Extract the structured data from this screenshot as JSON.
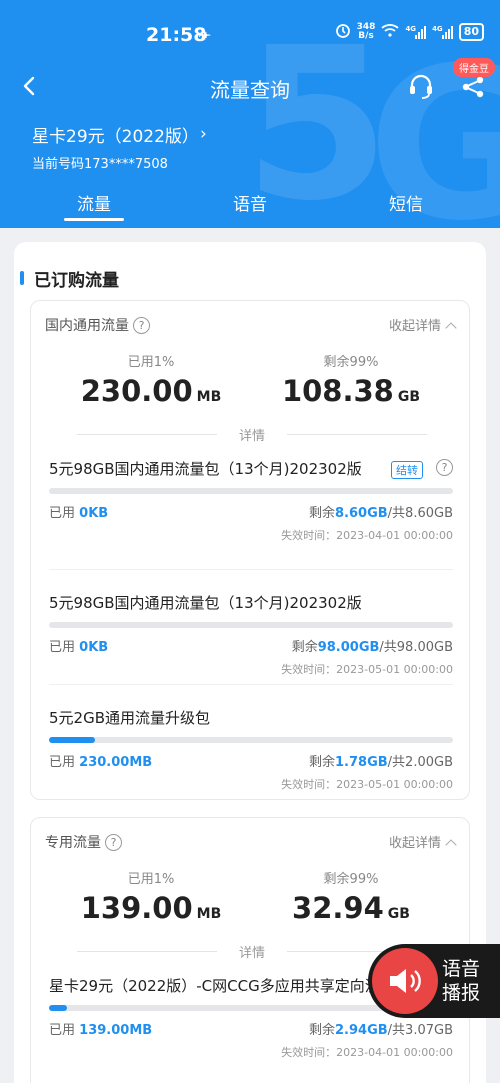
{
  "status_bar": {
    "time": "21:58",
    "speed_value": "348",
    "speed_unit": "B/s",
    "signal_label_1": "4G",
    "signal_label_2": "4G",
    "battery": "80"
  },
  "nav": {
    "title": "流量查询",
    "badge": "得金豆"
  },
  "plan": {
    "name": "星卡29元（2022版）",
    "phone": "当前号码173****7508"
  },
  "tabs": [
    "流量",
    "语音",
    "短信"
  ],
  "subscribed": {
    "title": "已订购流量",
    "domestic": {
      "title": "国内通用流量",
      "collapse_label": "收起详情",
      "used_label": "已用1%",
      "used_value": "230.00",
      "used_unit": "MB",
      "remain_label": "剩余99%",
      "remain_value": "108.38",
      "remain_unit": "GB",
      "detail_label": "详情",
      "packages": [
        {
          "name": "5元98GB国内通用流量包（13个月)202302版",
          "tag": "结转",
          "used_prefix": "已用",
          "used": "0KB",
          "remain_prefix": "剩余",
          "remain": "8.60GB",
          "total": "/共8.60GB",
          "expiry": "失效时间：2023-04-01 00:00:00",
          "progress": 0
        },
        {
          "name": "5元98GB国内通用流量包（13个月)202302版",
          "used_prefix": "已用",
          "used": "0KB",
          "remain_prefix": "剩余",
          "remain": "98.00GB",
          "total": "/共98.00GB",
          "expiry": "失效时间：2023-05-01 00:00:00",
          "progress": 0
        },
        {
          "name": "5元2GB通用流量升级包",
          "used_prefix": "已用",
          "used": "230.00MB",
          "remain_prefix": "剩余",
          "remain": "1.78GB",
          "total": "/共2.00GB",
          "expiry": "失效时间：2023-05-01 00:00:00",
          "progress": 0.115
        }
      ]
    },
    "dedicated": {
      "title": "专用流量",
      "collapse_label": "收起详情",
      "used_label": "已用1%",
      "used_value": "139.00",
      "used_unit": "MB",
      "remain_label": "剩余99%",
      "remain_value": "32.94",
      "remain_unit": "GB",
      "detail_label": "详情",
      "packages": [
        {
          "name": "星卡29元（2022版）-C网CCG多应用共享定向流量",
          "used_prefix": "已用",
          "used": "139.00MB",
          "remain_prefix": "剩余",
          "remain": "2.94GB",
          "total": "/共3.07GB",
          "expiry": "失效时间：2023-04-01 00:00:00",
          "progress": 0.045
        }
      ]
    }
  },
  "voice_button": {
    "label": "语音播报"
  },
  "colors": {
    "brand_blue": "#1f8ff0",
    "voice_red": "#e94545"
  }
}
